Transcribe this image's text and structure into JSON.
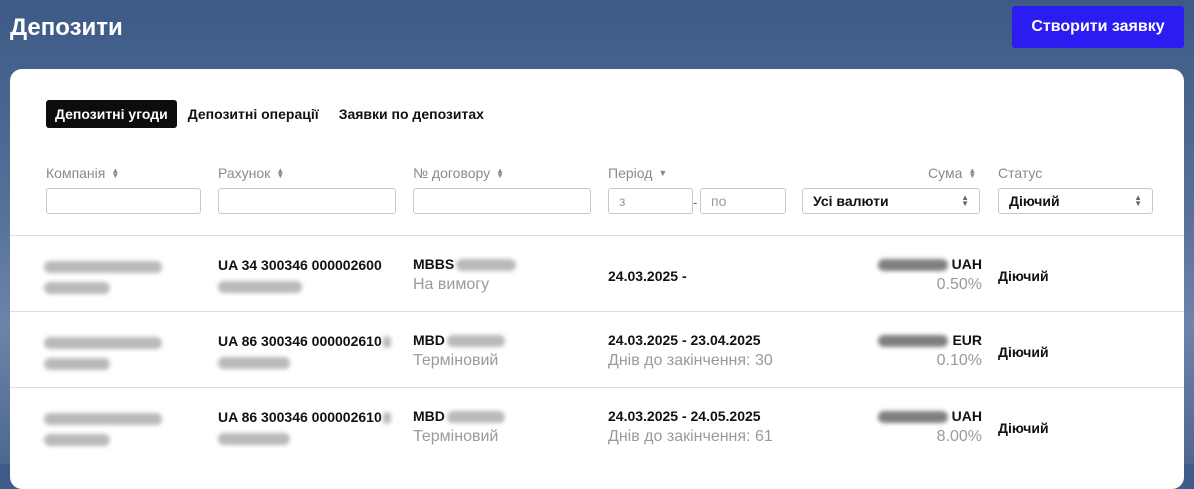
{
  "header": {
    "title": "Депозити",
    "create_button": "Створити заявку"
  },
  "tabs": [
    {
      "label": "Депозитні угоди",
      "active": true
    },
    {
      "label": "Депозитні операції",
      "active": false
    },
    {
      "label": "Заявки по депозитах",
      "active": false
    }
  ],
  "columns": {
    "company": "Компанія",
    "account": "Рахунок",
    "contract": "№ договору",
    "period": "Період",
    "amount": "Сума",
    "status": "Статус"
  },
  "filters": {
    "period_from_placeholder": "з",
    "period_to_placeholder": "по",
    "currency_selected": "Усі валюти",
    "status_selected": "Діючий"
  },
  "rows": [
    {
      "account": "UA 34 300346 000002600",
      "contract_prefix": "MBBS",
      "contract_type": "На вимогу",
      "period": "24.03.2025 -",
      "days_left": "",
      "currency": "UAH",
      "rate": "0.50%",
      "status": "Діючий"
    },
    {
      "account": "UA 86 300346 000002610",
      "contract_prefix": "MBD",
      "contract_type": "Терміновий",
      "period": "24.03.2025 - 23.04.2025",
      "days_left": "Днів до закінчення: 30",
      "currency": "EUR",
      "rate": "0.10%",
      "status": "Діючий"
    },
    {
      "account": "UA 86 300346 000002610",
      "contract_prefix": "MBD",
      "contract_type": "Терміновий",
      "period": "24.03.2025 - 24.05.2025",
      "days_left": "Днів до закінчення: 61",
      "currency": "UAH",
      "rate": "8.00%",
      "status": "Діючий"
    }
  ]
}
